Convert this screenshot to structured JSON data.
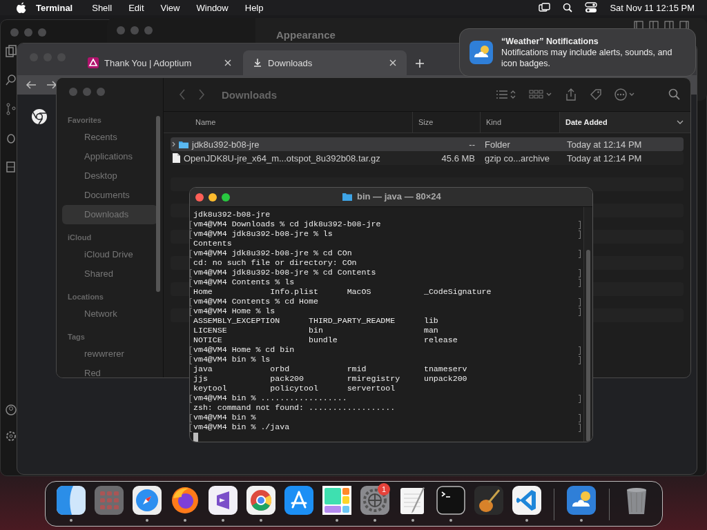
{
  "menu_bar": {
    "app": "Terminal",
    "menus": [
      "Shell",
      "Edit",
      "View",
      "Window",
      "Help"
    ],
    "clock": "Sat Nov 11  12:15 PM"
  },
  "back_window": {
    "title": "Appearance"
  },
  "browser": {
    "tabs": [
      {
        "label": "Thank You | Adoptium",
        "kind": "site",
        "selected": false
      },
      {
        "label": "Downloads",
        "kind": "download",
        "selected": true
      }
    ]
  },
  "finder": {
    "title": "Downloads",
    "sidebar": [
      {
        "heading": "Favorites",
        "items": [
          {
            "label": "Recents",
            "selected": false
          },
          {
            "label": "Applications",
            "selected": false
          },
          {
            "label": "Desktop",
            "selected": false
          },
          {
            "label": "Documents",
            "selected": false
          },
          {
            "label": "Downloads",
            "selected": true
          }
        ]
      },
      {
        "heading": "iCloud",
        "items": [
          {
            "label": "iCloud Drive",
            "selected": false
          },
          {
            "label": "Shared",
            "selected": false
          }
        ]
      },
      {
        "heading": "Locations",
        "items": [
          {
            "label": "Network",
            "selected": false
          }
        ]
      },
      {
        "heading": "Tags",
        "items": [
          {
            "label": "rewwrerer",
            "selected": false
          },
          {
            "label": "Red",
            "selected": false
          }
        ]
      }
    ],
    "columns": [
      {
        "label": "Name",
        "sorted": false
      },
      {
        "label": "Size",
        "sorted": false
      },
      {
        "label": "Kind",
        "sorted": false
      },
      {
        "label": "Date Added",
        "sorted": true
      }
    ],
    "rows": [
      {
        "kind": "folder",
        "name": "jdk8u392-b08-jre",
        "size": "--",
        "file_kind": "Folder",
        "date_added": "Today at 12:14 PM",
        "selected": true
      },
      {
        "kind": "file",
        "name": "OpenJDK8U-jre_x64_m...otspot_8u392b08.tar.gz",
        "size": "45.6 MB",
        "file_kind": "gzip co...archive",
        "date_added": "Today at 12:14 PM",
        "selected": false
      }
    ]
  },
  "terminal": {
    "title": "bin — java — 80×24",
    "lines": [
      {
        "text": "jdk8u392-b08-jre",
        "marked": false
      },
      {
        "text": "vm4@VM4 Downloads % cd jdk8u392-b08-jre",
        "marked": true
      },
      {
        "text": "vm4@VM4 jdk8u392-b08-jre % ls",
        "marked": true
      },
      {
        "text": "Contents",
        "marked": false
      },
      {
        "text": "vm4@VM4 jdk8u392-b08-jre % cd COn",
        "marked": true
      },
      {
        "text": "cd: no such file or directory: COn",
        "marked": false
      },
      {
        "text": "vm4@VM4 jdk8u392-b08-jre % cd Contents",
        "marked": true
      },
      {
        "text": "vm4@VM4 Contents % ls",
        "marked": true
      },
      {
        "text": "Home            Info.plist      MacOS           _CodeSignature",
        "marked": false
      },
      {
        "text": "vm4@VM4 Contents % cd Home",
        "marked": true
      },
      {
        "text": "vm4@VM4 Home % ls",
        "marked": true
      },
      {
        "text": "ASSEMBLY_EXCEPTION      THIRD_PARTY_README      lib",
        "marked": false
      },
      {
        "text": "LICENSE                 bin                     man",
        "marked": false
      },
      {
        "text": "NOTICE                  bundle                  release",
        "marked": false
      },
      {
        "text": "vm4@VM4 Home % cd bin",
        "marked": true
      },
      {
        "text": "vm4@VM4 bin % ls",
        "marked": true
      },
      {
        "text": "java            orbd            rmid            tnameserv",
        "marked": false
      },
      {
        "text": "jjs             pack200         rmiregistry     unpack200",
        "marked": false
      },
      {
        "text": "keytool         policytool      servertool",
        "marked": false
      },
      {
        "text": "vm4@VM4 bin % ..................",
        "marked": true
      },
      {
        "text": "zsh: command not found: ..................",
        "marked": false
      },
      {
        "text": "vm4@VM4 bin %",
        "marked": true
      },
      {
        "text": "vm4@VM4 bin % ./java",
        "marked": true
      }
    ]
  },
  "notification": {
    "title": "“Weather” Notifications",
    "body": "Notifications may include alerts, sounds, and icon badges."
  },
  "dock": {
    "apps": [
      {
        "kind": "finder",
        "running": true
      },
      {
        "kind": "launchpad",
        "running": false
      },
      {
        "kind": "safari",
        "running": true
      },
      {
        "kind": "firefox",
        "running": true
      },
      {
        "kind": "vs",
        "running": true
      },
      {
        "kind": "chrome",
        "running": true
      },
      {
        "kind": "appstore",
        "running": false
      },
      {
        "kind": "tiles",
        "running": true
      },
      {
        "kind": "settings",
        "running": true,
        "badge": "1"
      },
      {
        "kind": "textedit",
        "running": true
      },
      {
        "kind": "terminal",
        "running": true
      },
      {
        "kind": "guitar",
        "running": false
      },
      {
        "kind": "vscode",
        "running": true
      }
    ],
    "recent": [
      {
        "kind": "weather",
        "running": true
      }
    ],
    "trash": {
      "kind": "trash",
      "running": false
    }
  }
}
